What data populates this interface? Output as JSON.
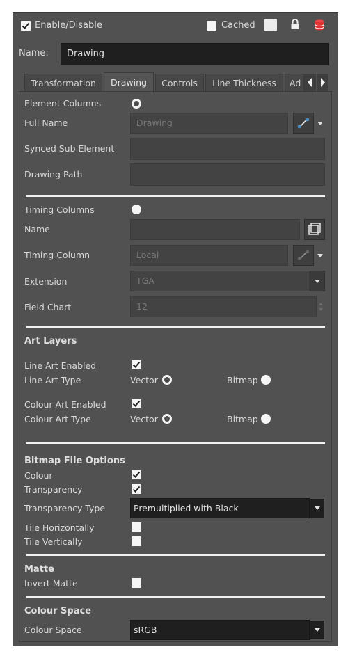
{
  "header": {
    "enable_label": "Enable/Disable",
    "cached_label": "Cached",
    "name_label": "Name:",
    "name_value": "Drawing"
  },
  "tabs": [
    {
      "label": "Transformation"
    },
    {
      "label": "Drawing"
    },
    {
      "label": "Controls"
    },
    {
      "label": "Line Thickness"
    },
    {
      "label": "Ad"
    }
  ],
  "element": {
    "element_columns_label": "Element Columns",
    "full_name_label": "Full Name",
    "full_name_value": "Drawing",
    "synced_label": "Synced Sub Element",
    "drawing_path_label": "Drawing Path"
  },
  "timing": {
    "timing_columns_label": "Timing Columns",
    "name_label": "Name",
    "timing_column_label": "Timing Column",
    "timing_column_value": "Local",
    "extension_label": "Extension",
    "extension_value": "TGA",
    "field_chart_label": "Field Chart",
    "field_chart_value": "12"
  },
  "art_layers": {
    "title": "Art Layers",
    "line_art_enabled_label": "Line Art Enabled",
    "line_art_type_label": "Line Art Type",
    "colour_art_enabled_label": "Colour Art Enabled",
    "colour_art_type_label": "Colour Art Type",
    "vector_label": "Vector",
    "bitmap_label": "Bitmap"
  },
  "bitmap_options": {
    "title": "Bitmap File Options",
    "colour_label": "Colour",
    "transparency_label": "Transparency",
    "transparency_type_label": "Transparency Type",
    "transparency_type_value": "Premultiplied with Black",
    "tile_h_label": "Tile Horizontally",
    "tile_v_label": "Tile Vertically"
  },
  "matte": {
    "title": "Matte",
    "invert_label": "Invert Matte"
  },
  "colour_space": {
    "title": "Colour Space",
    "label": "Colour Space",
    "value": "sRGB"
  },
  "colors": {
    "panel_bg": "#515151",
    "field_bg": "#434343",
    "dark_field_bg": "#1f1f1f",
    "accent": "#4a90c8"
  }
}
